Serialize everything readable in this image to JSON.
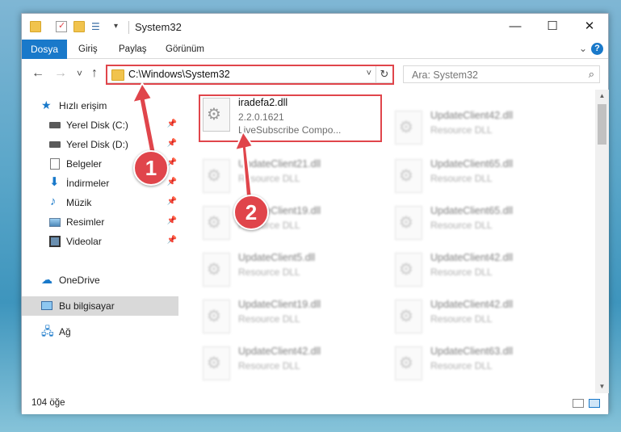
{
  "window": {
    "title": "System32",
    "controls": {
      "minimize": "—",
      "maximize": "☐",
      "close": "✕"
    }
  },
  "ribbon": {
    "tabs": [
      "Dosya",
      "Giriş",
      "Paylaş",
      "Görünüm"
    ],
    "expand": "⌄",
    "help": "?"
  },
  "nav": {
    "back": "←",
    "forward": "→",
    "recent": "˅",
    "up": "↑",
    "address": "C:\\Windows\\System32",
    "address_dropdown": "˅",
    "refresh": "↻",
    "search_placeholder": "Ara: System32"
  },
  "sidebar": {
    "quick_access": "Hızlı erişim",
    "items": [
      {
        "label": "Yerel Disk (C:)",
        "icon": "drive-icon"
      },
      {
        "label": "Yerel Disk (D:)",
        "icon": "drive-icon"
      },
      {
        "label": "Belgeler",
        "icon": "documents-icon"
      },
      {
        "label": "İndirmeler",
        "icon": "downloads-icon"
      },
      {
        "label": "Müzik",
        "icon": "music-icon"
      },
      {
        "label": "Resimler",
        "icon": "pictures-icon"
      },
      {
        "label": "Videolar",
        "icon": "videos-icon"
      }
    ],
    "onedrive": "OneDrive",
    "this_pc": "Bu bilgisayar",
    "network": "Ağ"
  },
  "files": {
    "highlighted": {
      "name": "iradefa2.dll",
      "version": "2.2.0.1621",
      "description": "LiveSubscribe Compo..."
    },
    "left_column": [
      {
        "name": "UpdateClient21.dll",
        "desc": "Resource DLL"
      },
      {
        "name": "UpdateClient19.dll",
        "desc": "Resource DLL"
      },
      {
        "name": "UpdateClient5.dll",
        "desc": "Resource DLL"
      },
      {
        "name": "UpdateClient19.dll",
        "desc": "Resource DLL"
      },
      {
        "name": "UpdateClient42.dll",
        "desc": "Resource DLL"
      }
    ],
    "right_column": [
      {
        "name": "UpdateClient42.dll",
        "desc": "Resource DLL"
      },
      {
        "name": "UpdateClient65.dll",
        "desc": "Resource DLL"
      },
      {
        "name": "UpdateClient65.dll",
        "desc": "Resource DLL"
      },
      {
        "name": "UpdateClient42.dll",
        "desc": "Resource DLL"
      },
      {
        "name": "UpdateClient42.dll",
        "desc": "Resource DLL"
      },
      {
        "name": "UpdateClient63.dll",
        "desc": "Resource DLL"
      }
    ]
  },
  "status": {
    "item_count": "104 öğe"
  },
  "callouts": {
    "one": "1",
    "two": "2"
  },
  "colors": {
    "accent": "#1979ca",
    "highlight": "#e0454b",
    "folder": "#f1c34d"
  }
}
